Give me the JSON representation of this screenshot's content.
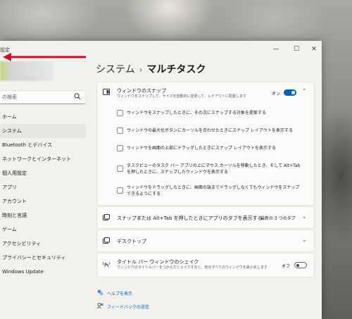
{
  "window": {
    "title": "設定",
    "controls": {
      "minimize": "—",
      "maximize": "☐",
      "close": "✕"
    }
  },
  "search": {
    "placeholder": "の検索"
  },
  "sidebar": {
    "items": [
      {
        "label": "ホーム"
      },
      {
        "label": "システム",
        "active": true
      },
      {
        "label": "Bluetooth とデバイス"
      },
      {
        "label": "ネットワークとインターネット"
      },
      {
        "label": "個人用設定"
      },
      {
        "label": "アプリ"
      },
      {
        "label": "アカウント"
      },
      {
        "label": "時刻と言語"
      },
      {
        "label": "ゲーム"
      },
      {
        "label": "アクセシビリティ"
      },
      {
        "label": "プライバシーとセキュリティ"
      },
      {
        "label": "Windows Update"
      }
    ]
  },
  "breadcrumb": {
    "parent": "システム",
    "separator": "›",
    "current": "マルチタスク"
  },
  "snap": {
    "title": "ウィンドウのスナップ",
    "subtitle": "ウィンドウをスナップして、サイズを自動的に変更して、レイアウトに配置します",
    "toggle_label": "オン",
    "toggle_on": true,
    "options": [
      "ウィンドウをスナップしたときに、その次にスナップする対象を提案する",
      "ウィンドウの最大化ボタンにカーソルを合わせたときにスナップ レイアウトを表示する",
      "ウィンドウを画面の上部にドラッグしたときにスナップ レイアウトを表示する",
      "タスクビューのタスク バー アプリの上にマウス カーソルを移動したとき、そして Alt+Tab を押したときに、スナップしたウィンドウを表示する",
      "ウィンドウをドラッグしたときに、画面の端までドラッグしなくてもウィンドウをスナップできるようにする"
    ]
  },
  "alttab": {
    "title": "スナップまたは Alt+Tab を押したときにアプリのタブを表示する",
    "value": "最新の 3 つのタブ"
  },
  "desktops": {
    "title": "デスクトップ"
  },
  "shake": {
    "title": "タイトル バー ウィンドウのシェイク",
    "subtitle": "ウィンドウのタイトルバーをつかんでシェイクすると、他のすべてのウィンドウを最小化します",
    "toggle_label": "オフ",
    "toggle_on": false
  },
  "links": {
    "help": "ヘルプを表示",
    "feedback": "フィードバックの送信"
  },
  "colors": {
    "accent": "#005fb8",
    "arrow": "#c8102e"
  }
}
